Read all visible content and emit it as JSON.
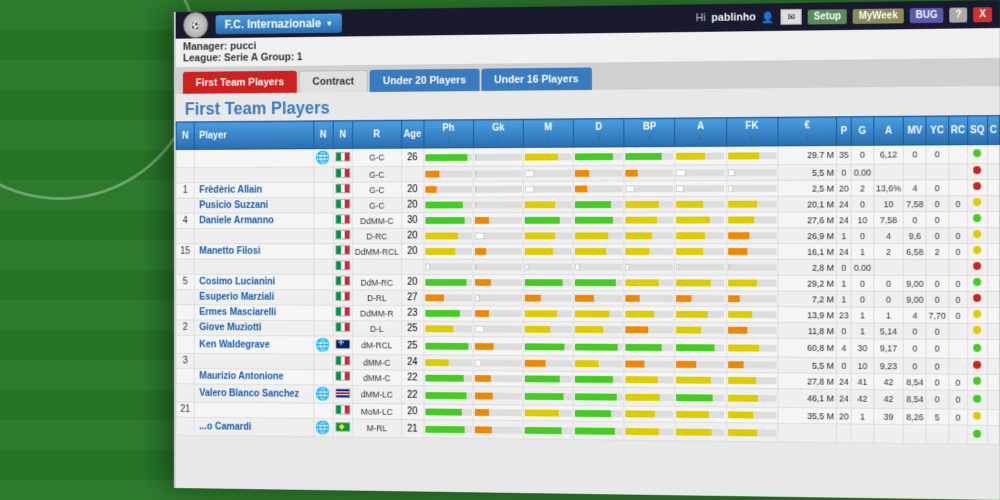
{
  "background": {
    "color": "#2d7a2d"
  },
  "topbar": {
    "club_name": "F.C. Internazionale",
    "hi_text": "Hi",
    "username": "pablinho",
    "buttons": {
      "setup": "Setup",
      "myweek": "MyWeek",
      "bug": "BUG",
      "question": "?",
      "close": "X"
    }
  },
  "subbar": {
    "manager_label": "Manager:",
    "manager_value": "pucci",
    "league_label": "League:",
    "league_value": "Serie A Group: 1"
  },
  "tabs": [
    {
      "label": "First Team Players",
      "active": true,
      "style": "red"
    },
    {
      "label": "Contract",
      "active": false,
      "style": "dark"
    },
    {
      "label": "Under 20 Players",
      "active": false,
      "style": "blue"
    },
    {
      "label": "Under 16 Players",
      "active": false,
      "style": "blue"
    }
  ],
  "section_title": "First Team Players",
  "table": {
    "headers": [
      "N",
      "Player",
      "N",
      "N",
      "R",
      "Age",
      "Ph",
      "Gk",
      "M",
      "D",
      "BP",
      "A",
      "FK",
      "€",
      "P",
      "G",
      "A",
      "MV",
      "YC",
      "RC",
      "SQ",
      "C"
    ],
    "rows": [
      {
        "num": "",
        "name": "",
        "nat1": "globe",
        "nat2": "it",
        "role": "G-C",
        "age": 26,
        "bars": [
          90,
          0,
          70,
          80,
          75,
          60,
          65
        ],
        "vals": "29.7 M  35  0  6,12  0  0"
      },
      {
        "num": "",
        "name": "",
        "nat1": "",
        "nat2": "it",
        "role": "G-C",
        "age": "",
        "bars": [
          30,
          0,
          20,
          30,
          25,
          20,
          15
        ],
        "vals": "5,5 M  0  0.00"
      },
      {
        "num": 1,
        "name": "Frèdèric Allain",
        "nat1": "",
        "nat2": "it",
        "role": "G-C",
        "age": 20,
        "bars": [
          25,
          0,
          20,
          25,
          20,
          15,
          10
        ],
        "vals": "2,5 M  20  2  13,6%  4  0"
      },
      {
        "num": "",
        "name": "Pusicio Suzzani",
        "nat1": "",
        "nat2": "it",
        "role": "G-C",
        "age": 20,
        "bars": [
          80,
          0,
          65,
          75,
          70,
          55,
          60
        ],
        "vals": "20,1 M  24  0  10  7,58  0  0"
      },
      {
        "num": 4,
        "name": "Daniele Armanno",
        "nat1": "",
        "nat2": "it",
        "role": "DdMM-C",
        "age": 30,
        "bars": [
          85,
          30,
          75,
          80,
          65,
          70,
          55
        ],
        "vals": "27,6 M  24  10  7,58  0  0"
      },
      {
        "num": "",
        "name": "",
        "nat1": "",
        "nat2": "it",
        "role": "D-RC",
        "age": 20,
        "bars": [
          70,
          20,
          65,
          70,
          55,
          60,
          45
        ],
        "vals": "26,9 M  1  0  4  9,6  0  0"
      },
      {
        "num": 15,
        "name": "Manetto Filosi",
        "nat1": "",
        "nat2": "it",
        "role": "DdMM-RCL",
        "age": 20,
        "bars": [
          65,
          25,
          60,
          65,
          50,
          55,
          40
        ],
        "vals": "16,1 M  24  1  2  6,58  2  0"
      },
      {
        "num": "",
        "name": "",
        "nat1": "",
        "nat2": "it",
        "role": "",
        "age": "",
        "bars": [
          10,
          0,
          8,
          10,
          8,
          6,
          5
        ],
        "vals": "2,8 M  0  0.00"
      },
      {
        "num": 5,
        "name": "Cosimo Lucianini",
        "nat1": "",
        "nat2": "it",
        "role": "DdM-RC",
        "age": 20,
        "bars": [
          88,
          35,
          80,
          85,
          70,
          72,
          60
        ],
        "vals": "29,2 M  1  0  0  9,00  0  0"
      },
      {
        "num": "",
        "name": "Esuperio Marziali",
        "nat1": "",
        "nat2": "it",
        "role": "D-RL",
        "age": 27,
        "bars": [
          40,
          10,
          35,
          40,
          30,
          32,
          25
        ],
        "vals": "7,2 M  1  0  0  9,00  0  0"
      },
      {
        "num": "",
        "name": "Ermes Masciarelli",
        "nat1": "",
        "nat2": "it",
        "role": "DdMM-R",
        "age": 23,
        "bars": [
          75,
          30,
          68,
          72,
          60,
          65,
          50
        ],
        "vals": "13,9 M  23  1  1  4  7,70  0"
      },
      {
        "num": 2,
        "name": "Giove Muziotti",
        "nat1": "",
        "nat2": "it",
        "role": "D-L",
        "age": 25,
        "bars": [
          60,
          20,
          55,
          60,
          48,
          52,
          40
        ],
        "vals": "11,8 M  0  1  5,14  0  0"
      },
      {
        "num": "",
        "name": "Ken Waldegrave",
        "nat1": "globe",
        "nat2": "uk",
        "role": "dM-RCL",
        "age": 25,
        "bars": [
          92,
          40,
          85,
          90,
          75,
          80,
          65
        ],
        "vals": "60,8 M  4  30  9,17  0  0"
      },
      {
        "num": 3,
        "name": "",
        "nat1": "",
        "nat2": "it",
        "role": "dMM-C",
        "age": 24,
        "bars": [
          50,
          15,
          45,
          50,
          40,
          42,
          32
        ],
        "vals": "5,5 M  0  10  9,23  0  0"
      },
      {
        "num": "",
        "name": "Maurizio Antonione",
        "nat1": "",
        "nat2": "it",
        "role": "dMM-C",
        "age": 22,
        "bars": [
          82,
          35,
          75,
          80,
          68,
          72,
          58
        ],
        "vals": "27,8 M  24  41  42  8,54  0  0"
      },
      {
        "num": "",
        "name": "Valero Blanco Sanchez",
        "nat1": "globe",
        "nat2": "cu",
        "role": "dMM-LC",
        "age": 22,
        "bars": [
          88,
          38,
          82,
          87,
          72,
          76,
          62
        ],
        "vals": "46,1 M  24  42  42  8,54  0  0"
      },
      {
        "num": 21,
        "name": "",
        "nat1": "",
        "nat2": "it",
        "role": "MoM-LC",
        "age": 20,
        "bars": [
          78,
          30,
          72,
          76,
          62,
          68,
          52
        ],
        "vals": "35,5 M  20  1  39  8,26  5  0"
      },
      {
        "num": "",
        "name": "...o Camardi",
        "nat1": "globe",
        "nat2": "br",
        "role": "M-RL",
        "age": 21,
        "bars": [
          85,
          36,
          78,
          83,
          70,
          74,
          60
        ],
        "vals": ""
      }
    ]
  }
}
